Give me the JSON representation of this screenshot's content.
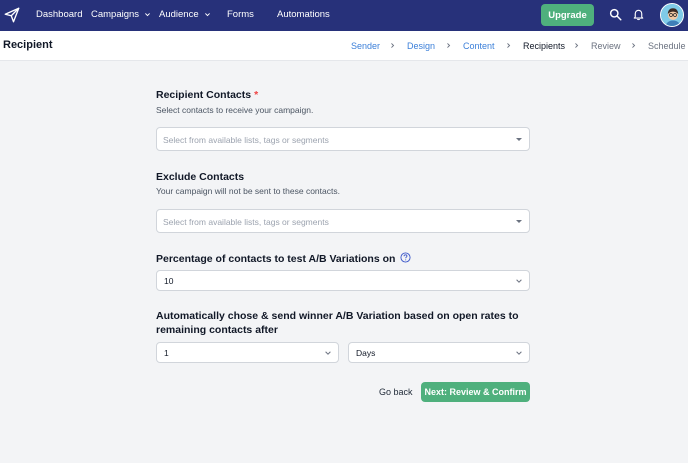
{
  "topnav": {
    "items": [
      {
        "label": "Dashboard"
      },
      {
        "label": "Campaigns"
      },
      {
        "label": "Audience"
      },
      {
        "label": "Forms"
      },
      {
        "label": "Automations"
      }
    ],
    "upgrade_label": "Upgrade",
    "icons": [
      "paper-plane-logo-icon",
      "search-icon",
      "bell-icon",
      "user-avatar"
    ],
    "colors": {
      "nav_bg": "#27317a",
      "accent": "#4fb07d"
    }
  },
  "subheader": {
    "title": "Recipient",
    "steps": [
      {
        "label": "Sender",
        "state": "done"
      },
      {
        "label": "Design",
        "state": "done"
      },
      {
        "label": "Content",
        "state": "done"
      },
      {
        "label": "Recipients",
        "state": "active"
      },
      {
        "label": "Review",
        "state": "future"
      },
      {
        "label": "Schedule",
        "state": "future"
      }
    ]
  },
  "form": {
    "recipient": {
      "label": "Recipient Contacts",
      "required_mark": "*",
      "help": "Select contacts to receive your campaign.",
      "placeholder": "Select from available lists, tags or segments"
    },
    "exclude": {
      "label": "Exclude Contacts",
      "help": "Your campaign will not be sent to these contacts.",
      "placeholder": "Select from available lists, tags or segments"
    },
    "percentage": {
      "label": "Percentage of contacts to test A/B Variations on",
      "value": "10"
    },
    "winner": {
      "label_line1": "Automatically chose & send winner A/B Variation based on open rates to",
      "label_line2": "remaining contacts after",
      "amount": "1",
      "unit": "Days"
    }
  },
  "actions": {
    "back_label": "Go back",
    "next_label": "Next: Review & Confirm"
  }
}
